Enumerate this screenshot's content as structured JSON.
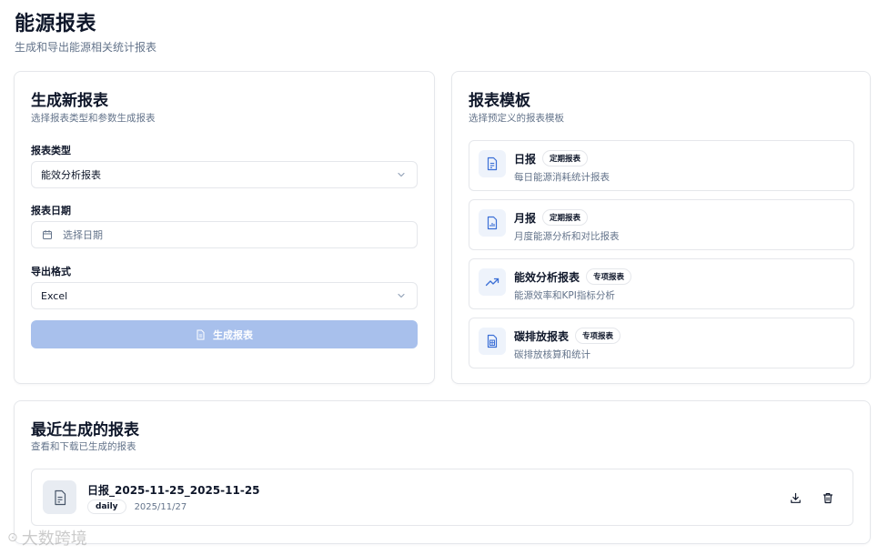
{
  "header": {
    "title": "能源报表",
    "subtitle": "生成和导出能源相关统计报表"
  },
  "generate": {
    "title": "生成新报表",
    "description": "选择报表类型和参数生成报表",
    "type_label": "报表类型",
    "type_value": "能效分析报表",
    "date_label": "报表日期",
    "date_placeholder": "选择日期",
    "format_label": "导出格式",
    "format_value": "Excel",
    "button_label": "生成报表"
  },
  "templates": {
    "title": "报表模板",
    "description": "选择预定义的报表模板",
    "items": [
      {
        "name": "日报",
        "badge": "定期报表",
        "desc": "每日能源消耗统计报表",
        "icon": "file-text-icon"
      },
      {
        "name": "月报",
        "badge": "定期报表",
        "desc": "月度能源分析和对比报表",
        "icon": "file-chart-icon"
      },
      {
        "name": "能效分析报表",
        "badge": "专项报表",
        "desc": "能源效率和KPI指标分析",
        "icon": "trending-up-icon"
      },
      {
        "name": "碳排放报表",
        "badge": "专项报表",
        "desc": "碳排放核算和统计",
        "icon": "file-spreadsheet-icon"
      }
    ]
  },
  "recent": {
    "title": "最近生成的报表",
    "description": "查看和下载已生成的报表",
    "items": [
      {
        "name": "日报_2025-11-25_2025-11-25",
        "tag": "daily",
        "date": "2025/11/27"
      }
    ]
  },
  "watermark": "大数跨境",
  "colors": {
    "primary_disabled": "#a8c0ec",
    "icon_blue": "#3b6fd6",
    "border": "#e5e7eb",
    "muted_text": "#64748b"
  }
}
